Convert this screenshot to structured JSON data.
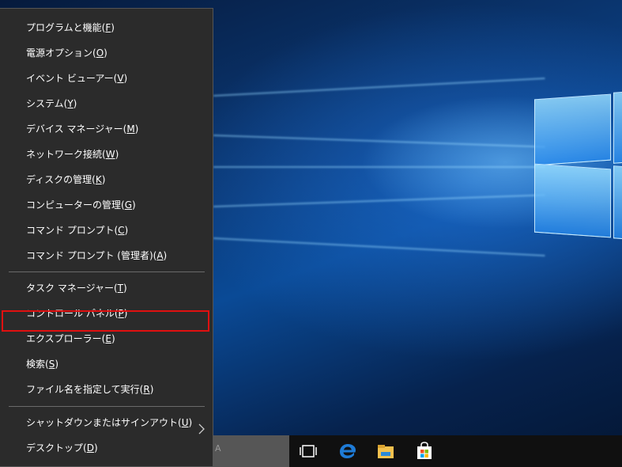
{
  "menu": {
    "items": [
      {
        "label": "プログラムと機能",
        "key": "F"
      },
      {
        "label": "電源オプション",
        "key": "O"
      },
      {
        "label": "イベント ビューアー",
        "key": "V"
      },
      {
        "label": "システム",
        "key": "Y"
      },
      {
        "label": "デバイス マネージャー",
        "key": "M"
      },
      {
        "label": "ネットワーク接続",
        "key": "W"
      },
      {
        "label": "ディスクの管理",
        "key": "K"
      },
      {
        "label": "コンピューターの管理",
        "key": "G"
      },
      {
        "label": "コマンド プロンプト",
        "key": "C"
      },
      {
        "label": "コマンド プロンプト (管理者)",
        "key": "A"
      },
      {
        "label": "タスク マネージャー",
        "key": "T"
      },
      {
        "label": "コントロール パネル",
        "key": "P"
      },
      {
        "label": "エクスプローラー",
        "key": "E"
      },
      {
        "label": "検索",
        "key": "S"
      },
      {
        "label": "ファイル名を指定して実行",
        "key": "R"
      },
      {
        "label": "シャットダウンまたはサインアウト",
        "key": "U"
      },
      {
        "label": "デスクトップ",
        "key": "D"
      }
    ]
  },
  "taskbar": {
    "search_partial": "A"
  },
  "colors": {
    "menu_bg": "#2b2b2b",
    "highlight_border": "#e01010",
    "edge_blue": "#1e7bd6",
    "explorer_yellow": "#f2c14e"
  },
  "icons": [
    "task-view-icon",
    "edge-browser-icon",
    "file-explorer-icon",
    "store-icon",
    "submenu-arrow-icon"
  ]
}
